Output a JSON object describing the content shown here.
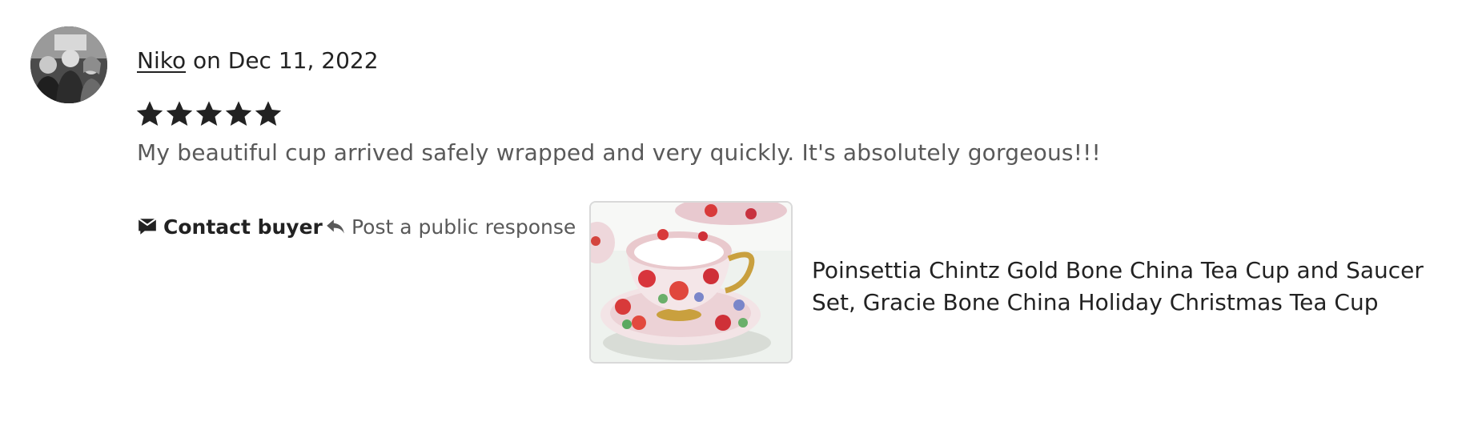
{
  "review": {
    "reviewer_name": "Niko",
    "date_prefix": " on ",
    "date": "Dec 11, 2022",
    "rating": 5,
    "text": "My beautiful cup arrived safely wrapped and very quickly. It's absolutely gorgeous!!!"
  },
  "actions": {
    "contact_buyer_label": "Contact buyer",
    "post_response_label": "Post a public response"
  },
  "product": {
    "title": "Poinsettia Chintz Gold Bone China Tea Cup and Saucer Set, Gracie Bone China Holiday Christmas Tea Cup"
  },
  "icons": {
    "avatar": "avatar-photo",
    "star": "star-icon",
    "contact": "message-icon",
    "reply": "reply-arrow-icon"
  },
  "colors": {
    "text_primary": "#222222",
    "text_secondary": "#595959",
    "thumb_border": "#d9d9d9"
  }
}
